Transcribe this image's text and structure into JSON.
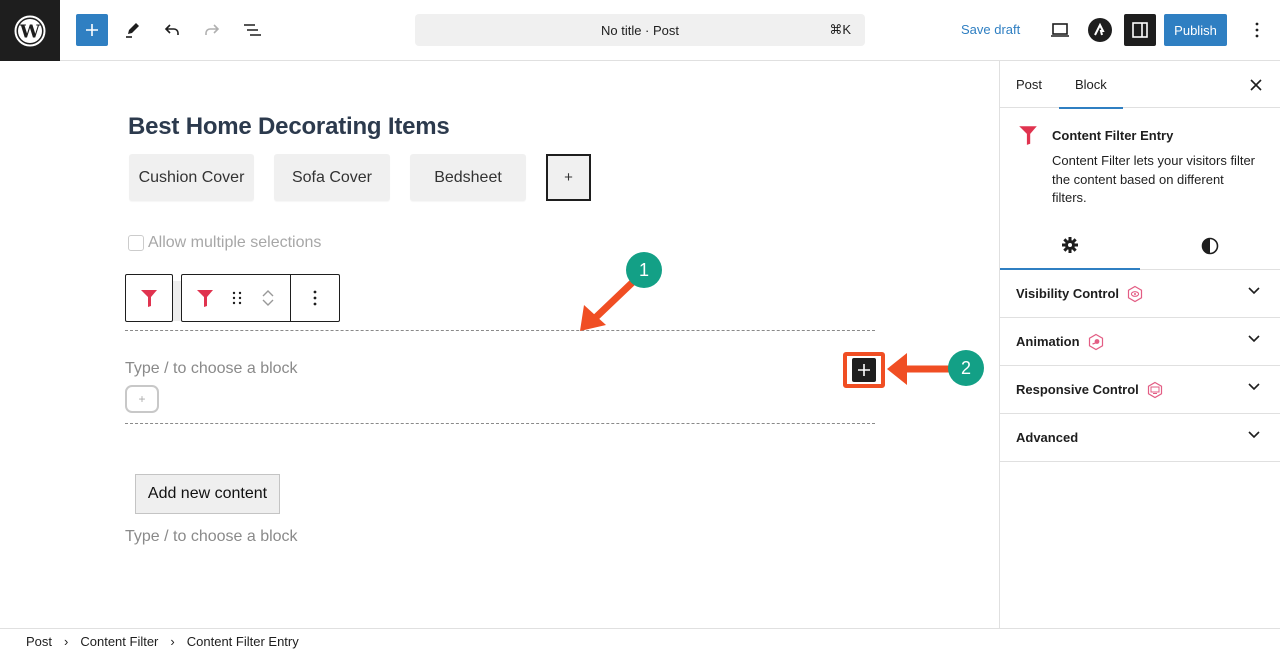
{
  "topbar": {
    "document_title": "No title · Post",
    "shortcut": "⌘K",
    "save_draft": "Save draft",
    "publish": "Publish",
    "icons": [
      "wordpress-logo",
      "plus-icon",
      "pencil-icon",
      "undo-icon",
      "redo-icon",
      "list-view-icon",
      "desktop-preview-icon",
      "astra-icon",
      "sidebar-toggle-icon",
      "more-vertical-icon"
    ]
  },
  "editor": {
    "heading": "Best Home Decorating Items",
    "filters": [
      "Cushion Cover",
      "Sofa Cover",
      "Bedsheet"
    ],
    "add_filter_label": "+",
    "allow_multiple_label": "Allow multiple selections",
    "allow_multiple_checked": false,
    "block_placeholder": "Type / to choose a block",
    "mini_add_label": "+",
    "add_new_content": "Add new content",
    "block_placeholder_2": "Type / to choose a block",
    "annotations": [
      {
        "number": "1",
        "color": "#13a086"
      },
      {
        "number": "2",
        "color": "#13a086"
      }
    ],
    "accent_color": "#f04e23"
  },
  "sidebar": {
    "tabs": [
      {
        "label": "Post",
        "active": false
      },
      {
        "label": "Block",
        "active": true
      }
    ],
    "block": {
      "name": "Content Filter Entry",
      "description": "Content Filter lets your visitors filter the content based on different filters.",
      "icon_color": "#e0334f"
    },
    "subtabs": [
      {
        "icon": "settings-gear-icon",
        "active": true
      },
      {
        "icon": "styles-contrast-icon",
        "active": false
      }
    ],
    "panels": [
      {
        "label": "Visibility Control",
        "icon": "visibility-icon"
      },
      {
        "label": "Animation",
        "icon": "animation-icon"
      },
      {
        "label": "Responsive Control",
        "icon": "responsive-icon"
      },
      {
        "label": "Advanced",
        "icon": null
      }
    ]
  },
  "breadcrumb": [
    "Post",
    "Content Filter",
    "Content Filter Entry"
  ],
  "colors": {
    "brand_blue": "#2f7fc2",
    "dark": "#1e1e1e",
    "filter_red": "#e0334f"
  }
}
